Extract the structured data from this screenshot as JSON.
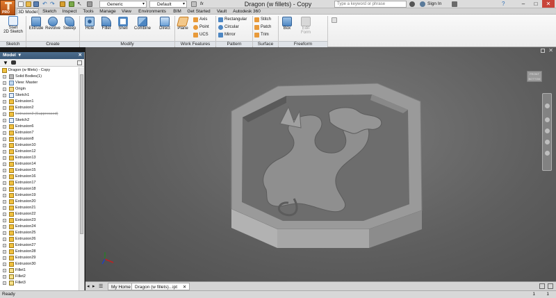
{
  "window": {
    "title": "Dragon (w fillets) - Copy",
    "appearance_dropdown": "Generic",
    "material_dropdown": "Default",
    "search_placeholder": "Type a keyword or phrase",
    "sign_in": "Sign In",
    "app_badge": "PRO"
  },
  "tabs": [
    {
      "label": "3D Model",
      "active": true
    },
    {
      "label": "Sketch"
    },
    {
      "label": "Inspect"
    },
    {
      "label": "Tools"
    },
    {
      "label": "Manage"
    },
    {
      "label": "View"
    },
    {
      "label": "Environments"
    },
    {
      "label": "BIM"
    },
    {
      "label": "Get Started"
    },
    {
      "label": "Vault"
    },
    {
      "label": "Autodesk 360"
    }
  ],
  "ribbon": {
    "start_sketch_line1": "Start",
    "start_sketch_line2": "2D Sketch",
    "extrude": "Extrude",
    "revolve": "Revolve",
    "sweep": "Sweep",
    "hole": "Hole",
    "fillet": "Fillet",
    "shell": "Shell",
    "combine": "Combine",
    "direct": "Direct",
    "plane": "Plane",
    "axis": "Axis",
    "point": "Point",
    "ucs": "UCS",
    "rectangular": "Rectangular",
    "circular": "Circular",
    "mirror": "Mirror",
    "stitch": "Stitch",
    "patch": "Patch",
    "trim": "Trim",
    "box": "Box",
    "edit_form_line1": "Edit",
    "edit_form_line2": "Form",
    "groups": {
      "sketch": "Sketch",
      "create": "Create",
      "modify": "Modify",
      "work_features": "Work Features",
      "pattern": "Pattern",
      "surface": "Surface",
      "freeform": "Freeform"
    }
  },
  "browser": {
    "title": "Model",
    "root": "Dragon (w fillets) - Copy",
    "items": [
      "Solid Bodies(1)",
      "View: Master",
      "Origin",
      "Sketch1",
      "Extrusion1",
      "Extrusion2",
      "Extrusion3 (Suppressed)",
      "Sketch2",
      "Extrusion6",
      "Extrusion7",
      "Extrusion8",
      "Extrusion10",
      "Extrusion12",
      "Extrusion13",
      "Extrusion14",
      "Extrusion15",
      "Extrusion16",
      "Extrusion17",
      "Extrusion18",
      "Extrusion19",
      "Extrusion20",
      "Extrusion21",
      "Extrusion22",
      "Extrusion23",
      "Extrusion24",
      "Extrusion25",
      "Extrusion26",
      "Extrusion27",
      "Extrusion28",
      "Extrusion29",
      "Extrusion30",
      "Fillet1",
      "Fillet2",
      "Fillet3"
    ]
  },
  "viewcube": {
    "top": "FRONT",
    "bottom": "BOTTOM"
  },
  "doc_tabs": {
    "home": "My Home",
    "doc": "Dragon (w fillets)...ipt"
  },
  "status": {
    "left": "Ready",
    "right1": "1",
    "right2": "1"
  },
  "colors": {
    "accent": "#d1650e",
    "viewport": "#6a6a6a",
    "browser_header": "#3e5c7a"
  }
}
